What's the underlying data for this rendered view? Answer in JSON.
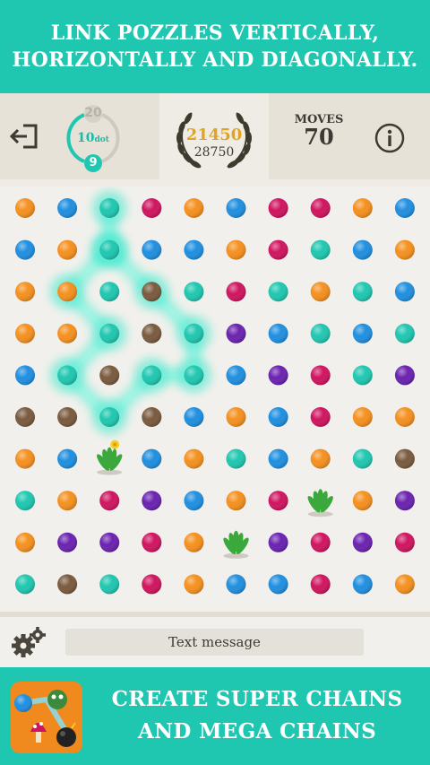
{
  "top_banner": {
    "line1": "LINK POZZLES VERTICALLY,",
    "line2": "HORIZONTALLY AND DIAGONALLY."
  },
  "header": {
    "exit_icon": "exit-icon",
    "ring_top": "20",
    "ring_mid": "10",
    "ring_mid_unit": "dot",
    "ring_bottom": "9",
    "score": "21450",
    "best_score": "28750",
    "moves_label": "MOVES",
    "moves_value": "70",
    "info_icon": "info-icon"
  },
  "colors": {
    "teal": "#1fc7b0",
    "orange": "#f5901e",
    "blue": "#1f8fe0",
    "magenta": "#d0145f",
    "purple": "#6a22b0",
    "brown": "#7a5a3e",
    "score_gold": "#e5a21c"
  },
  "board": {
    "rows": [
      [
        "O",
        "B",
        "T",
        "M",
        "O",
        "B",
        "M",
        "M",
        "O",
        "B"
      ],
      [
        "B",
        "O",
        "T",
        "B",
        "B",
        "O",
        "M",
        "T",
        "B",
        "O"
      ],
      [
        "O",
        "O",
        "T",
        "N",
        "T",
        "M",
        "T",
        "O",
        "T",
        "B"
      ],
      [
        "O",
        "O",
        "T",
        "N",
        "T",
        "P",
        "B",
        "T",
        "B",
        "T"
      ],
      [
        "B",
        "T",
        "N",
        "T",
        "T",
        "B",
        "P",
        "M",
        "T",
        "P"
      ],
      [
        "N",
        "N",
        "T",
        "N",
        "B",
        "O",
        "B",
        "M",
        "O",
        "O"
      ],
      [
        "O",
        "B",
        "F",
        "B",
        "O",
        "T",
        "B",
        "O",
        "T",
        "N"
      ],
      [
        "T",
        "O",
        "M",
        "P",
        "B",
        "O",
        "M",
        "F",
        "O",
        "P"
      ],
      [
        "O",
        "P",
        "P",
        "M",
        "O",
        "F",
        "P",
        "M",
        "P",
        "M"
      ],
      [
        "T",
        "N",
        "T",
        "M",
        "O",
        "B",
        "B",
        "M",
        "B",
        "O"
      ]
    ],
    "chain": [
      [
        0,
        2
      ],
      [
        1,
        2
      ],
      [
        2,
        1
      ],
      [
        3,
        2
      ],
      [
        4,
        1
      ],
      [
        5,
        2
      ],
      [
        4,
        3
      ],
      [
        4,
        4
      ],
      [
        3,
        4
      ],
      [
        2,
        3
      ],
      [
        1,
        2
      ]
    ],
    "flowers": [
      {
        "row": 6,
        "col": 2,
        "kind": "yellow-flower"
      },
      {
        "row": 7,
        "col": 7,
        "kind": "green-plant"
      },
      {
        "row": 8,
        "col": 5,
        "kind": "green-plant"
      }
    ]
  },
  "bottom_bar": {
    "settings_icon": "gears-icon",
    "message_placeholder": "Text message"
  },
  "footer": {
    "app_icon": "app-icon",
    "line1": "CREATE SUPER CHAINS",
    "line2": "AND MEGA CHAINS"
  }
}
